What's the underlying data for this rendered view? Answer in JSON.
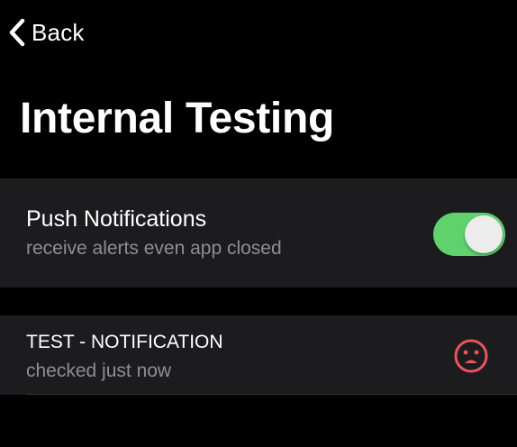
{
  "nav": {
    "back_label": "Back"
  },
  "page": {
    "title": "Internal Testing"
  },
  "push_notifications": {
    "title": "Push Notifications",
    "subtitle": "receive alerts even app closed",
    "enabled": true
  },
  "test_notification": {
    "title": "TEST - NOTIFICATION",
    "subtitle": "checked just now",
    "status_icon": "frown-face-icon"
  },
  "colors": {
    "background": "#000000",
    "row_background": "#1c1c1e",
    "secondary_text": "#8e8e93",
    "toggle_on": "#5fd16d",
    "status_error": "#e8555e"
  }
}
